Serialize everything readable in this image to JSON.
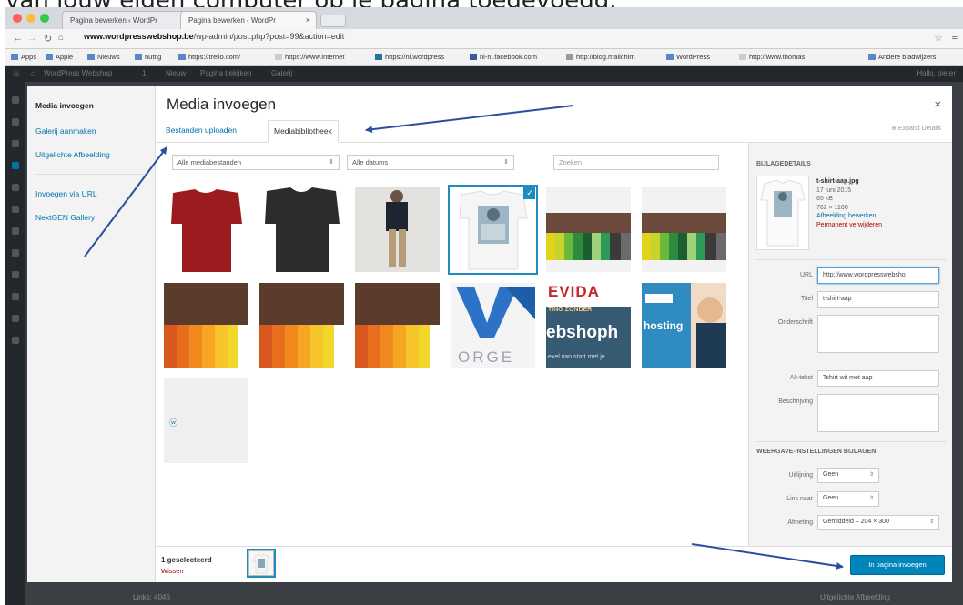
{
  "caption": "van jouw eigen computer op je pagina toegevoegd.",
  "browser": {
    "tabs": [
      {
        "label": "Pagina bewerken ‹ WordPr"
      },
      {
        "label": "Pagina bewerken ‹ WordPr"
      }
    ],
    "url_domain": "www.wordpresswebshop.be",
    "url_path": "/wp-admin/post.php?post=99&action=edit",
    "bookmarks": [
      "Apps",
      "Apple",
      "Nieuws",
      "nuttig",
      "https://trello.com/",
      "https://www.internet",
      "https://nl.wordpress",
      "nl-nl.facebook.com",
      "http://blog.mailchim",
      "WordPress",
      "http://www.thomas",
      "Andere bladwijzers"
    ]
  },
  "admin_bar": {
    "site": "WordPress Webshop",
    "comments": "1",
    "new": "Nieuw",
    "view": "Pagina bekijken",
    "gallery": "Galerij",
    "user": "Hallo, pieter"
  },
  "background": {
    "bottom_left": "Links: 4046",
    "bottom_right": "Uitgelichte Afbeelding"
  },
  "modal": {
    "title": "Media invoegen",
    "close": "×",
    "sidebar": {
      "items": [
        {
          "label": "Media invoegen",
          "active": true
        },
        {
          "label": "Galerij aanmaken",
          "active": false
        },
        {
          "label": "Uitgelichte Afbeelding",
          "active": false
        },
        {
          "label": "Invoegen via URL",
          "active": false
        },
        {
          "label": "NextGEN Gallery",
          "active": false
        }
      ]
    },
    "tabs": [
      {
        "label": "Bestanden uploaden",
        "active": false
      },
      {
        "label": "Mediabibliotheek",
        "active": true
      }
    ],
    "expand_details": "Expand Details",
    "filters": {
      "type_filter": "Alle mediabestanden",
      "date_filter": "Alle datums",
      "search_placeholder": "Zoeken"
    },
    "grid_items": [
      {
        "kind": "red-tshirt",
        "selected": false
      },
      {
        "kind": "black-tshirt",
        "selected": false
      },
      {
        "kind": "person",
        "selected": false
      },
      {
        "kind": "printed-tshirt",
        "selected": true
      },
      {
        "kind": "tshirt-rack",
        "selected": false
      },
      {
        "kind": "tshirt-rack",
        "selected": false
      },
      {
        "kind": "orange-rack",
        "selected": false
      },
      {
        "kind": "orange-rack",
        "selected": false
      },
      {
        "kind": "orange-rack",
        "selected": false
      },
      {
        "kind": "logo",
        "selected": false,
        "text": "ORGE"
      },
      {
        "kind": "banner",
        "selected": false,
        "text_top": "EVIDA",
        "text_mid": "TING ZONDER",
        "text_big": "ebshoph",
        "text_small": "exel van start met je"
      },
      {
        "kind": "hosting",
        "selected": false,
        "text": "hosting"
      },
      {
        "kind": "blank",
        "selected": false
      }
    ],
    "details": {
      "heading": "BIJLAGEDETAILS",
      "filename": "t-shirt-aap.jpg",
      "date": "17 juni 2015",
      "size": "65 kB",
      "dimensions": "762 × 1100",
      "edit_link": "Afbeelding bewerken",
      "delete_link": "Permanent verwijderen",
      "fields": {
        "url_label": "URL",
        "url_value": "http://www.wordpresswebsho",
        "title_label": "Titel",
        "title_value": "t-shirt-aap",
        "caption_label": "Onderschrift",
        "alt_label": "Alt-tekst",
        "alt_value": "Tshirt wit met aap",
        "description_label": "Beschrijving"
      },
      "display_heading": "WEERGAVE-INSTELLINGEN BIJLAGEN",
      "display": {
        "align_label": "Uitlijning",
        "align_value": "Geen",
        "link_label": "Link naar",
        "link_value": "Geen",
        "size_label": "Afmeting",
        "size_value": "Gemiddeld – 204 × 300"
      }
    },
    "footer": {
      "selected_count": "1 geselecteerd",
      "clear": "Wissen",
      "insert_button": "In pagina invoegen"
    }
  },
  "colors": {
    "accent": "#0073aa",
    "button": "#0085ba",
    "arrow": "#2a4f9f",
    "selection": "#1e8cbe",
    "danger": "#aa0000"
  }
}
